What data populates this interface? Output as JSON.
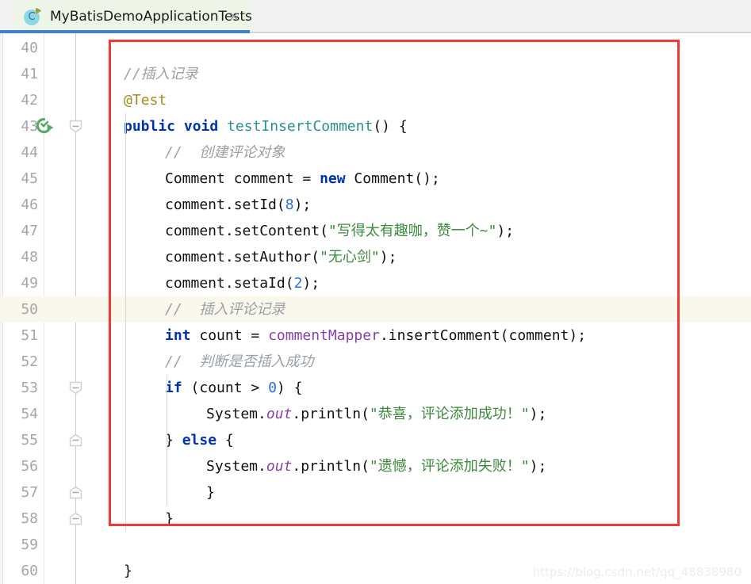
{
  "window": {
    "app": "IntelliJ IDEA Editor"
  },
  "tabbar": {
    "tab_title": "MyBatisDemoApplicationTests",
    "tab_icon": "java-test-class-icon",
    "close_icon": "×",
    "active_underline_color": "#4182c4",
    "active_tab_bg": "#edf6e6"
  },
  "editor": {
    "highlighted_line": 50,
    "highlight_color": "#faf8ec",
    "gutter_run_icon_line": 43,
    "run_icon_name": "run-test-success-icon",
    "annotation_rect_color": "#f23a35",
    "lines": [
      {
        "no": "40",
        "indent": 0,
        "tokens": []
      },
      {
        "no": "41",
        "indent": 0,
        "tokens": [
          {
            "t": "//插入记录",
            "c": "t-com"
          }
        ]
      },
      {
        "no": "42",
        "indent": 0,
        "tokens": [
          {
            "t": "@Test",
            "c": "t-ann"
          }
        ]
      },
      {
        "no": "43",
        "indent": 0,
        "tokens": [
          {
            "t": "public",
            "c": "t-kw"
          },
          {
            "t": " ",
            "c": "t-plain"
          },
          {
            "t": "void",
            "c": "t-kw"
          },
          {
            "t": " ",
            "c": "t-plain"
          },
          {
            "t": "testInsertComment",
            "c": "t-meth"
          },
          {
            "t": "() {",
            "c": "t-plain"
          }
        ]
      },
      {
        "no": "44",
        "indent": 1,
        "tokens": [
          {
            "t": "//  创建评论对象",
            "c": "t-com"
          }
        ]
      },
      {
        "no": "45",
        "indent": 1,
        "tokens": [
          {
            "t": "Comment comment = ",
            "c": "t-plain"
          },
          {
            "t": "new",
            "c": "t-kw"
          },
          {
            "t": " Comment();",
            "c": "t-plain"
          }
        ]
      },
      {
        "no": "46",
        "indent": 1,
        "tokens": [
          {
            "t": "comment.setId(",
            "c": "t-plain"
          },
          {
            "t": "8",
            "c": "t-num"
          },
          {
            "t": ");",
            "c": "t-plain"
          }
        ]
      },
      {
        "no": "47",
        "indent": 1,
        "tokens": [
          {
            "t": "comment.setContent(",
            "c": "t-plain"
          },
          {
            "t": "\"写得太有趣咖，赞一个~\"",
            "c": "t-str"
          },
          {
            "t": ");",
            "c": "t-plain"
          }
        ]
      },
      {
        "no": "48",
        "indent": 1,
        "tokens": [
          {
            "t": "comment.setAuthor(",
            "c": "t-plain"
          },
          {
            "t": "\"无心剑\"",
            "c": "t-str"
          },
          {
            "t": ");",
            "c": "t-plain"
          }
        ]
      },
      {
        "no": "49",
        "indent": 1,
        "tokens": [
          {
            "t": "comment.setaId(",
            "c": "t-plain"
          },
          {
            "t": "2",
            "c": "t-num"
          },
          {
            "t": ");",
            "c": "t-plain"
          }
        ]
      },
      {
        "no": "50",
        "indent": 1,
        "tokens": [
          {
            "t": "//  插入评论记录",
            "c": "t-com"
          }
        ]
      },
      {
        "no": "51",
        "indent": 1,
        "tokens": [
          {
            "t": "int",
            "c": "t-kw"
          },
          {
            "t": " count = ",
            "c": "t-plain"
          },
          {
            "t": "commentMapper",
            "c": "t-field"
          },
          {
            "t": ".insertComment(comment);",
            "c": "t-plain"
          }
        ]
      },
      {
        "no": "52",
        "indent": 1,
        "tokens": [
          {
            "t": "//  判断是否插入成功",
            "c": "t-com"
          }
        ]
      },
      {
        "no": "53",
        "indent": 1,
        "tokens": [
          {
            "t": "if",
            "c": "t-kw"
          },
          {
            "t": " (count > ",
            "c": "t-plain"
          },
          {
            "t": "0",
            "c": "t-num"
          },
          {
            "t": ") {",
            "c": "t-plain"
          }
        ]
      },
      {
        "no": "54",
        "indent": 2,
        "tokens": [
          {
            "t": "System.",
            "c": "t-plain"
          },
          {
            "t": "out",
            "c": "t-stat"
          },
          {
            "t": ".println(",
            "c": "t-plain"
          },
          {
            "t": "\"恭喜，评论添加成功！\"",
            "c": "t-str"
          },
          {
            "t": ");",
            "c": "t-plain"
          }
        ]
      },
      {
        "no": "55",
        "indent": 1,
        "tokens": [
          {
            "t": "} ",
            "c": "t-plain"
          },
          {
            "t": "else",
            "c": "t-kw"
          },
          {
            "t": " {",
            "c": "t-plain"
          }
        ]
      },
      {
        "no": "56",
        "indent": 2,
        "tokens": [
          {
            "t": "System.",
            "c": "t-plain"
          },
          {
            "t": "out",
            "c": "t-stat"
          },
          {
            "t": ".println(",
            "c": "t-plain"
          },
          {
            "t": "\"遗憾，评论添加失败！\"",
            "c": "t-str"
          },
          {
            "t": ");",
            "c": "t-plain"
          }
        ]
      },
      {
        "no": "57",
        "indent": 2,
        "tokens": [
          {
            "t": "}",
            "c": "t-plain"
          }
        ]
      },
      {
        "no": "58",
        "indent": 1,
        "tokens": [
          {
            "t": "}",
            "c": "t-plain"
          }
        ]
      },
      {
        "no": "59",
        "indent": 0,
        "tokens": []
      },
      {
        "no": "60",
        "indent": 0,
        "tokens": [
          {
            "t": "}",
            "c": "t-plain"
          }
        ]
      }
    ],
    "fold_markers": [
      {
        "line": "43",
        "dir": "down"
      },
      {
        "line": "53",
        "dir": "down"
      },
      {
        "line": "55",
        "dir": "up"
      },
      {
        "line": "57",
        "dir": "up"
      },
      {
        "line": "58",
        "dir": "up"
      }
    ]
  },
  "watermark": {
    "text": "https://blog.csdn.net/qq_48838980"
  }
}
